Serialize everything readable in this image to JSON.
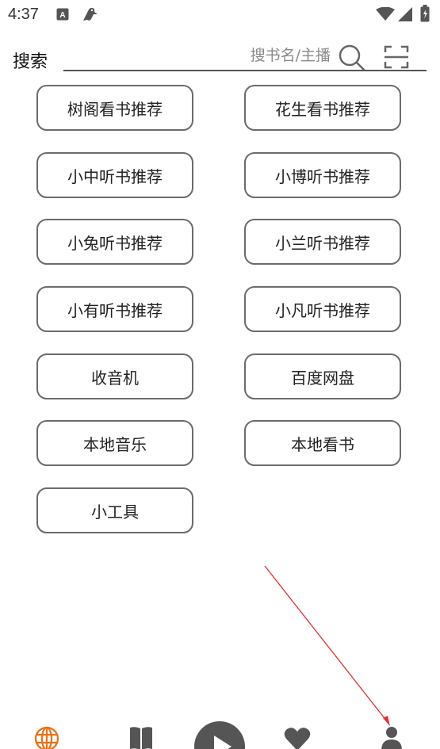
{
  "status": {
    "time": "4:37",
    "icons": [
      "a-badge-icon",
      "bird-icon",
      "wifi-icon",
      "signal-icon",
      "battery-icon"
    ]
  },
  "search": {
    "label": "搜索",
    "placeholder": "搜书名/主播",
    "search_icon": "search-icon",
    "scan_icon": "scan-icon"
  },
  "buttons": [
    "树阁看书推荐",
    "花生看书推荐",
    "小中听书推荐",
    "小博听书推荐",
    "小兔听书推荐",
    "小兰听书推荐",
    "小有听书推荐",
    "小凡听书推荐",
    "收音机",
    "百度网盘",
    "本地音乐",
    "本地看书",
    "小工具"
  ],
  "bottom_nav": [
    {
      "icon": "globe-icon",
      "active": true
    },
    {
      "icon": "book-icon",
      "active": false
    },
    {
      "icon": "play-icon",
      "active": false
    },
    {
      "icon": "heart-icon",
      "active": false
    },
    {
      "icon": "person-icon",
      "active": false
    }
  ],
  "colors": {
    "accent": "#e8741c",
    "nav_icon": "#555555",
    "button_border": "#6b6b6b",
    "annotation_arrow": "#e53030"
  }
}
